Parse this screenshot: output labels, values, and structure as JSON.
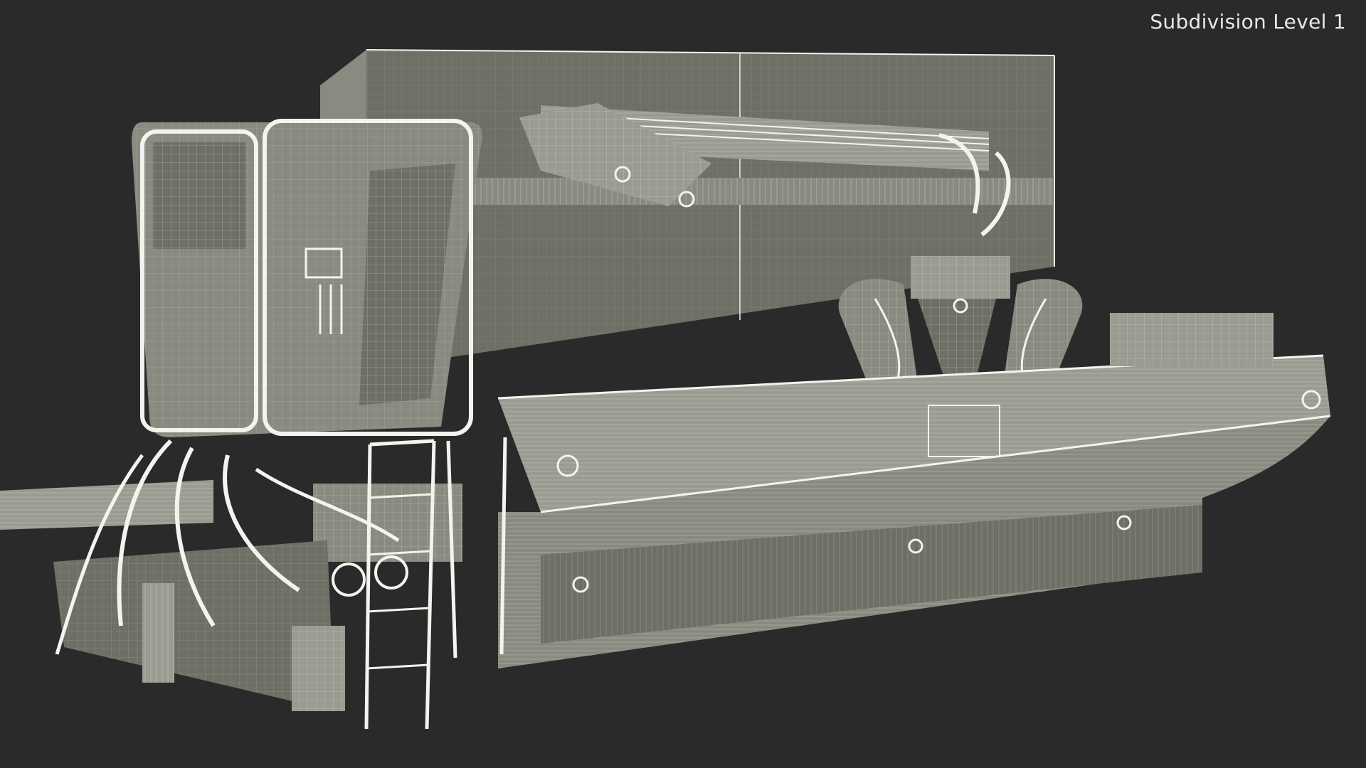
{
  "viewport": {
    "label": "Subdivision Level 1",
    "background_color": "#2a2a2a",
    "model_color": "#8a8a80",
    "wire_color": "#f4f4ee"
  },
  "scene": {
    "subject_icon": "wireframe-crane-barge-icon"
  }
}
